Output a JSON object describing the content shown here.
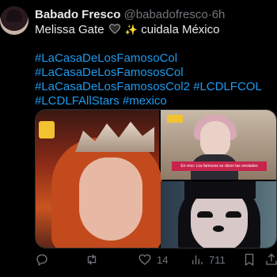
{
  "author": {
    "name": "Babado Fresco",
    "handle": "@babadofresco",
    "separator": "·",
    "time": "6h"
  },
  "tweet": {
    "line1_before": "Melissa Gate",
    "line1_after": "cuidala México",
    "heart_icon": "black-heart",
    "sparkle_glyph": "✨",
    "hashtags": [
      "#LaCasaDeLosFamosoCol",
      "#LaCasaDeLosFamososCol",
      "#LaCasaDeLosFamososCol2",
      "#LCDLFCOL",
      "#LCDLFAllStars",
      "#mexico"
    ]
  },
  "media": {
    "banner_text": "En vivo: Los famosos se dicen las verdades"
  },
  "actions": {
    "reply_count": "",
    "retweet_count": "",
    "like_count": "14",
    "views_count": "711"
  },
  "colors": {
    "link": "#1d9bf0",
    "muted": "#71767b",
    "text": "#e7e9ea",
    "background": "#000000"
  }
}
